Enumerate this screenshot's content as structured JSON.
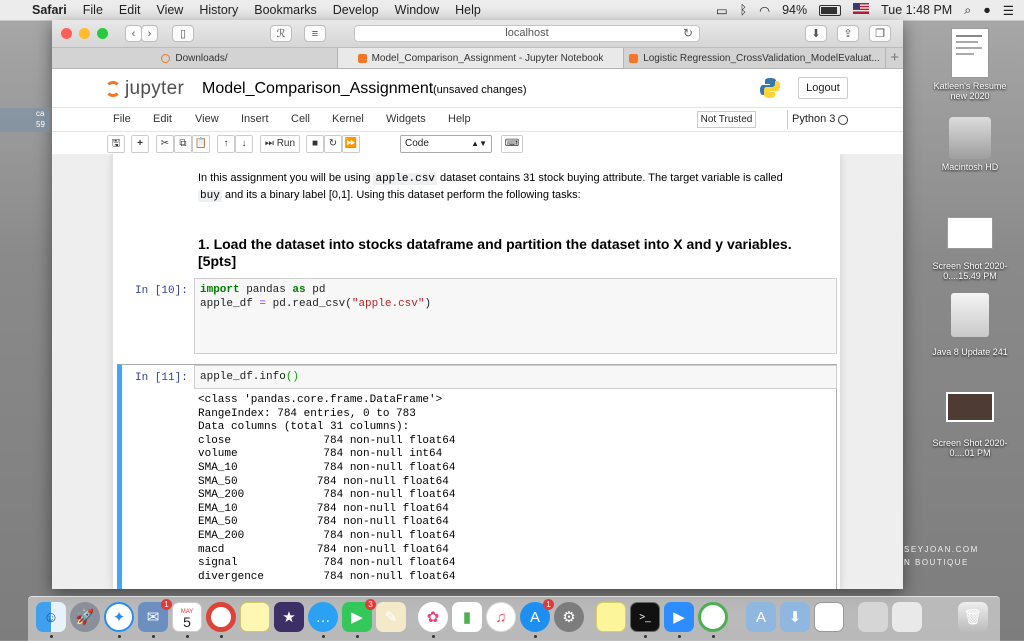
{
  "menubar": {
    "app": "Safari",
    "items": [
      "File",
      "Edit",
      "View",
      "History",
      "Bookmarks",
      "Develop",
      "Window",
      "Help"
    ],
    "battery": "94%",
    "clock": "Tue 1:48 PM"
  },
  "browser": {
    "url": "localhost",
    "tabs": [
      {
        "label": "Downloads/"
      },
      {
        "label": "Model_Comparison_Assignment - Jupyter Notebook"
      },
      {
        "label": "Logistic Regression_CrossValidation_ModelEvaluat..."
      }
    ],
    "new_tab": "+"
  },
  "jupyter": {
    "logo_text": "jupyter",
    "notebook_title": "Model_Comparison_Assignment",
    "save_status": "(unsaved changes)",
    "logout": "Logout",
    "menu": [
      "File",
      "Edit",
      "View",
      "Insert",
      "Cell",
      "Kernel",
      "Widgets",
      "Help"
    ],
    "trust": "Not Trusted",
    "kernel": "Python 3",
    "toolbar": {
      "run": "Run",
      "cell_type": "Code"
    }
  },
  "notebook": {
    "intro_1": "In this assignment you will be using ",
    "intro_code1": "apple.csv",
    "intro_2": " dataset contains 31 stock buying attribute. The target variable is called",
    "intro_code2": "buy",
    "intro_3": " and its a binary label [0,1]. Using this dataset perform the following tasks:",
    "heading": "1. Load the dataset into stocks dataframe and partition the dataset into X and y variables. [5pts]",
    "cells": [
      {
        "prompt": "In [10]:"
      },
      {
        "prompt": "In [11]:"
      }
    ],
    "output_lines": [
      "<class 'pandas.core.frame.DataFrame'>",
      "RangeIndex: 784 entries, 0 to 783",
      "Data columns (total 31 columns):",
      "close              784 non-null float64",
      "volume             784 non-null int64",
      "SMA_10             784 non-null float64",
      "SMA_50            784 non-null float64",
      "SMA_200            784 non-null float64",
      "EMA_10            784 non-null float64",
      "EMA_50            784 non-null float64",
      "EMA_200            784 non-null float64",
      "macd              784 non-null float64",
      "signal             784 non-null float64",
      "divergence         784 non-null float64"
    ]
  },
  "desktop": {
    "icons": [
      {
        "label": "Katleen's Resume new 2020"
      },
      {
        "label": "Macintosh HD"
      },
      {
        "label": "Screen Shot 2020-0....15.49 PM"
      },
      {
        "label": "Java 8 Update 241"
      },
      {
        "label": "Screen Shot 2020-0....01 PM"
      }
    ],
    "left_stub": [
      "ca",
      "59"
    ],
    "branding": [
      "SEYJOAN.COM",
      "N BOUTIQUE"
    ]
  },
  "dock": {
    "badges": {
      "contacts": "1",
      "appstore": "1",
      "messages": "3"
    },
    "calendar_month": "MAY",
    "calendar_day": "5"
  }
}
